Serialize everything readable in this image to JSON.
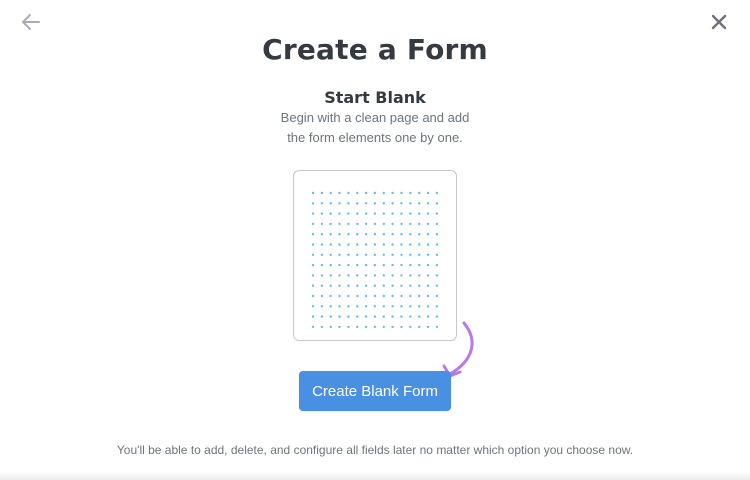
{
  "header": {
    "back_icon": "arrow-left-icon",
    "close_icon": "close-icon",
    "title": "Create a Form"
  },
  "option": {
    "title": "Start Blank",
    "description_line1": "Begin with a clean page and add",
    "description_line2": "the form elements one by one.",
    "preview_icon": "dot-grid-icon",
    "hint_arrow_icon": "curved-arrow-icon"
  },
  "actions": {
    "create_label": "Create Blank Form"
  },
  "footer": {
    "note": "You'll be able to add, delete, and configure all fields later no matter which option you choose now."
  },
  "colors": {
    "primary_button": "#4a90e2",
    "dots": "#6bb8f0",
    "arrow": "#b57be8",
    "title_text": "#343a40",
    "muted_text": "#6c757d"
  }
}
